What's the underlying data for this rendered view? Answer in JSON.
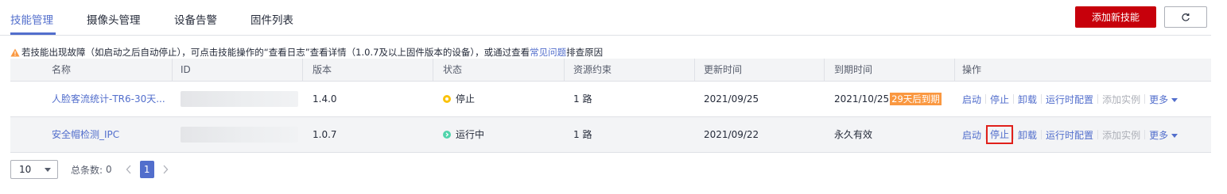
{
  "tabs": [
    "技能管理",
    "摄像头管理",
    "设备告警",
    "固件列表"
  ],
  "actions": {
    "add_label": "添加新技能"
  },
  "notice": {
    "text_before": "若技能出现故障（如启动之后自动停止），可点击技能操作的“查看日志”查看详情（1.0.7及以上固件版本的设备），或通过查看",
    "link": "常见问题",
    "text_after": " 排查原因"
  },
  "table": {
    "headers": [
      "名称",
      "ID",
      "版本",
      "状态",
      "资源约束",
      "更新时间",
      "到期时间",
      "操作"
    ],
    "rows": [
      {
        "name": "人脸客流统计-TR6-30天...",
        "version": "1.4.0",
        "status": "停止",
        "resource": "1 路",
        "updated": "2021/09/25",
        "expiry": "2021/10/25",
        "expiry_badge": "29天后到期"
      },
      {
        "name": "安全帽检测_IPC",
        "version": "1.0.7",
        "status": "运行中",
        "resource": "1 路",
        "updated": "2021/09/22",
        "expiry": "永久有效",
        "expiry_badge": ""
      }
    ],
    "operations": [
      "启动",
      "停止",
      "卸载",
      "运行时配置",
      "添加实例",
      "更多"
    ]
  },
  "pagination": {
    "page_size": "10",
    "total_label": "总条数:",
    "total": "0",
    "current_page": "1"
  },
  "colors": {
    "accent": "#526ecc",
    "danger": "#c7000b",
    "warning": "#fa9841",
    "running": "#50d4ab",
    "stopped": "#fac20a"
  }
}
